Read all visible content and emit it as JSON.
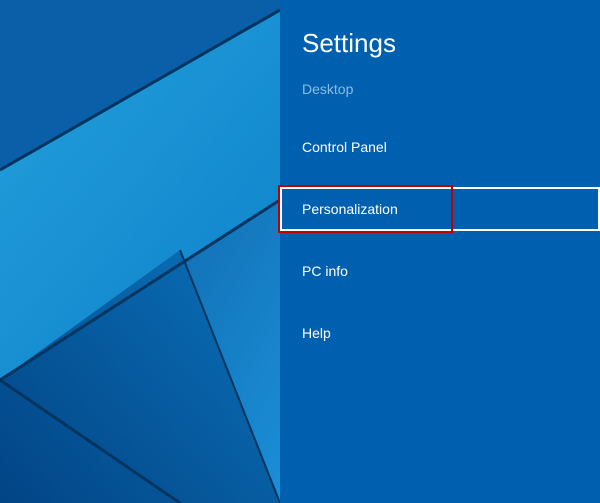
{
  "panel": {
    "title": "Settings",
    "context": "Desktop",
    "items": [
      {
        "label": "Control Panel"
      },
      {
        "label": "Personalization"
      },
      {
        "label": "PC info"
      },
      {
        "label": "Help"
      }
    ]
  }
}
